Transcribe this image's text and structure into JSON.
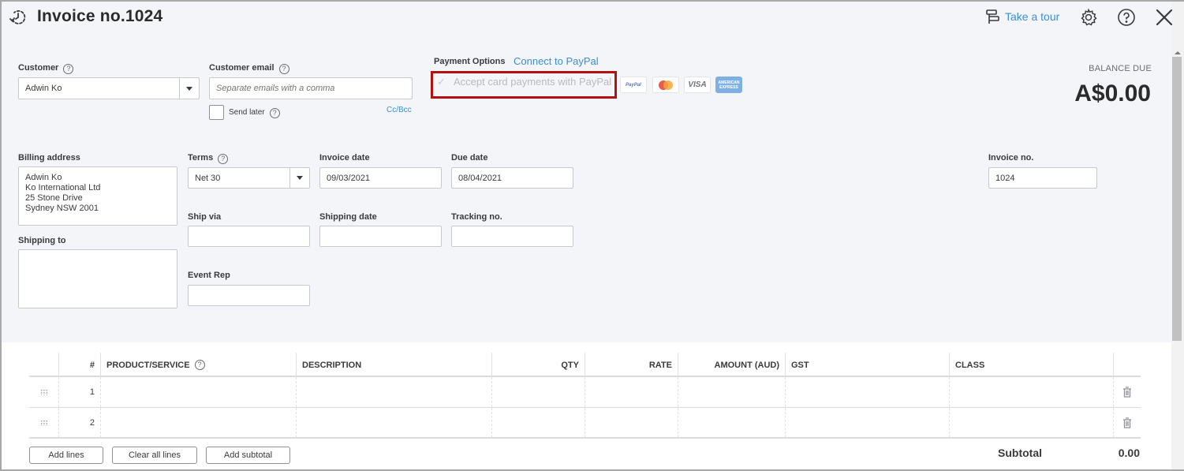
{
  "header": {
    "title": "Invoice no.1024",
    "history_icon": "clock-history-icon",
    "take_tour_label": "Take a tour",
    "tour_icon": "signpost-icon",
    "settings_icon": "gear-icon",
    "help_icon": "help-icon",
    "close_icon": "close-icon"
  },
  "customer": {
    "label": "Customer",
    "value": "Adwin Ko"
  },
  "customer_email": {
    "label": "Customer email",
    "placeholder": "Separate emails with a comma",
    "value": "",
    "send_later_label": "Send later",
    "send_later_checked": false,
    "cc_bcc_label": "Cc/Bcc"
  },
  "payment": {
    "label": "Payment Options",
    "connect_label": "Connect to PayPal",
    "accept_label": "Accept card payments with PayPal",
    "accept_checked": true,
    "accept_disabled": true,
    "cards": [
      "PayPal",
      "Mastercard",
      "VISA",
      "American Express"
    ],
    "highlight_color": "#b50f0f"
  },
  "balance": {
    "label": "BALANCE DUE",
    "value": "A$0.00"
  },
  "billing": {
    "label": "Billing address",
    "lines": [
      "Adwin Ko",
      "Ko International Ltd",
      "25 Stone Drive",
      "Sydney NSW  2001"
    ]
  },
  "shipping_to": {
    "label": "Shipping to",
    "value": ""
  },
  "terms": {
    "label": "Terms",
    "value": "Net 30"
  },
  "invoice_date": {
    "label": "Invoice date",
    "value": "09/03/2021"
  },
  "due_date": {
    "label": "Due date",
    "value": "08/04/2021"
  },
  "ship_via": {
    "label": "Ship via",
    "value": ""
  },
  "shipping_date": {
    "label": "Shipping date",
    "value": ""
  },
  "tracking_no": {
    "label": "Tracking no.",
    "value": ""
  },
  "event_rep": {
    "label": "Event Rep",
    "value": ""
  },
  "invoice_no": {
    "label": "Invoice no.",
    "value": "1024"
  },
  "table": {
    "columns": [
      "",
      "#",
      "PRODUCT/SERVICE",
      "DESCRIPTION",
      "QTY",
      "RATE",
      "AMOUNT (AUD)",
      "GST",
      "CLASS",
      ""
    ],
    "rows": [
      {
        "num": "1",
        "product": "",
        "description": "",
        "qty": "",
        "rate": "",
        "amount": "",
        "gst": "",
        "class": ""
      },
      {
        "num": "2",
        "product": "",
        "description": "",
        "qty": "",
        "rate": "",
        "amount": "",
        "gst": "",
        "class": ""
      }
    ]
  },
  "actions": {
    "add_lines": "Add lines",
    "clear_all_lines": "Clear all lines",
    "add_subtotal": "Add subtotal"
  },
  "subtotal": {
    "label": "Subtotal",
    "value": "0.00"
  },
  "colors": {
    "link": "#3a8fd6",
    "background": "#f4f5f8",
    "text": "#393a3d"
  }
}
